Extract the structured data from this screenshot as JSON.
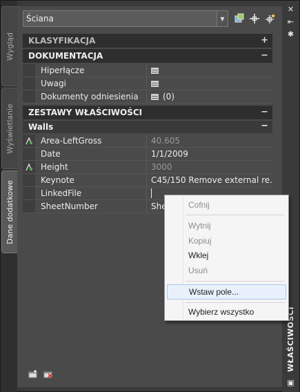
{
  "left_tabs": [
    {
      "label": "Wygląd",
      "active": false
    },
    {
      "label": "Wyświetlanie",
      "active": false
    },
    {
      "label": "Dane dodatkowe",
      "active": true
    }
  ],
  "toolbar": {
    "selection_value": "Ściana"
  },
  "sections": {
    "klasyfikacja": {
      "title": "KLASYFIKACJA",
      "toggle": "+"
    },
    "dokumentacja": {
      "title": "DOKUMENTACJA",
      "toggle": "−"
    },
    "zestawy": {
      "title": "ZESTAWY WŁAŚCIWOŚCI",
      "toggle": "−"
    },
    "walls": {
      "title": "Walls",
      "toggle": "−"
    }
  },
  "doc_rows": [
    {
      "name": "Hiperłącze",
      "value": ""
    },
    {
      "name": "Uwagi",
      "value": ""
    },
    {
      "name": "Dokumenty odniesienia",
      "value": "(0)"
    }
  ],
  "walls_rows": [
    {
      "name": "Area-LeftGross",
      "value": "40.605"
    },
    {
      "name": "Date",
      "value": "1/1/2009"
    },
    {
      "name": "Height",
      "value": "3000"
    },
    {
      "name": "Keynote",
      "value": "C45/150 Remove external re..."
    },
    {
      "name": "LinkedFile",
      "value": ""
    },
    {
      "name": "SheetNumber",
      "value": "She"
    }
  ],
  "context_menu": {
    "undo": "Cofnij",
    "cut": "Wytnij",
    "copy": "Kopiuj",
    "paste": "Wklej",
    "delete": "Usuń",
    "insert_field": "Wstaw pole...",
    "select_all": "Wybierz wszystko"
  },
  "right_title": "WŁAŚCIWOŚCI",
  "colors": {
    "panel": "#4a4a4a",
    "section_header": "#2e2e2e",
    "menu_highlight": "#e8f1fb"
  }
}
